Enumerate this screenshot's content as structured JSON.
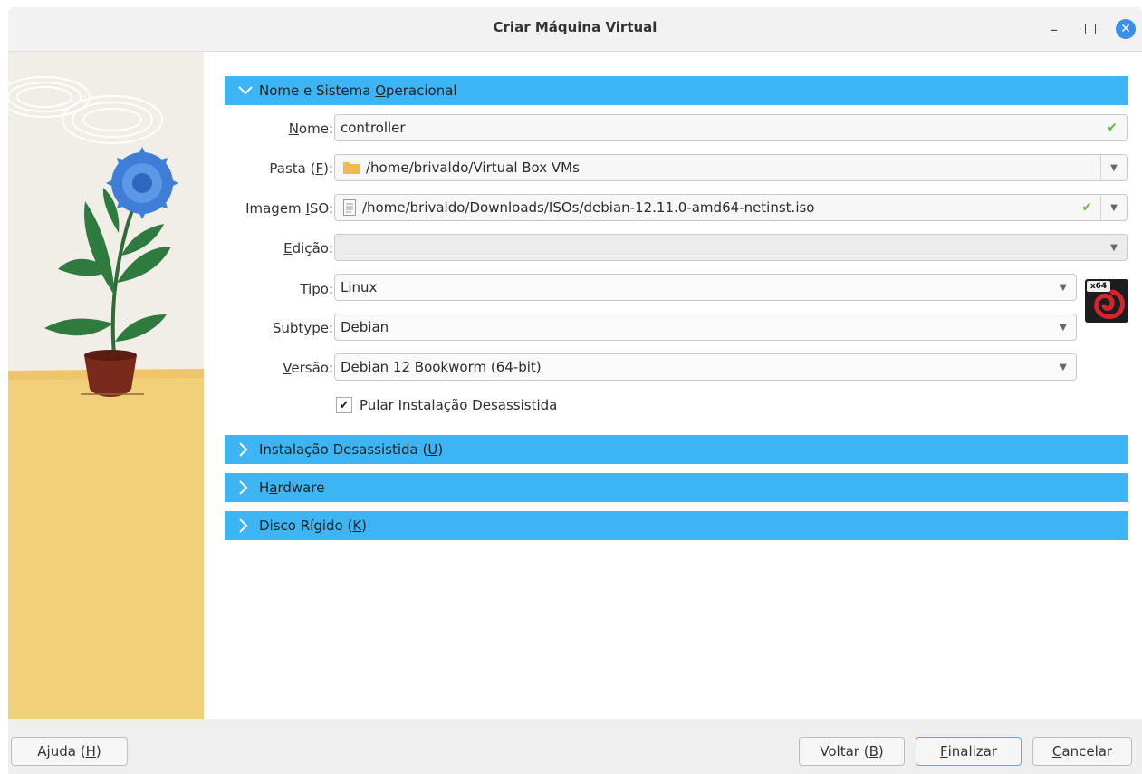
{
  "window": {
    "title": "Criar Máquina Virtual",
    "minimize_glyph": "–",
    "close_glyph": "✕"
  },
  "sections": {
    "name_os": {
      "label_pre": "Nome e Sistema ",
      "label_u": "O",
      "label_post": "peracional",
      "expanded": true
    },
    "unattended": {
      "label_pre": "Instalação Desassistida (",
      "label_u": "U",
      "label_post": ")",
      "expanded": false
    },
    "hardware": {
      "label_pre": "H",
      "label_u": "a",
      "label_post": "rdware",
      "expanded": false
    },
    "disk": {
      "label_pre": "Disco Rígido (",
      "label_u": "K",
      "label_post": ")",
      "expanded": false
    }
  },
  "form": {
    "name": {
      "label_pre": "",
      "label_u": "N",
      "label_post": "ome:",
      "value": "controller"
    },
    "folder": {
      "label_pre": "Pasta (",
      "label_u": "F",
      "label_post": "):",
      "value": "/home/brivaldo/Virtual Box VMs"
    },
    "iso": {
      "label_pre": "Imagem ",
      "label_u": "I",
      "label_post": "SO:",
      "value": "/home/brivaldo/Downloads/ISOs/debian-12.11.0-amd64-netinst.iso"
    },
    "edition": {
      "label_pre": "",
      "label_u": "E",
      "label_post": "dição:",
      "value": ""
    },
    "type": {
      "label_pre": "",
      "label_u": "T",
      "label_post": "ipo:",
      "value": "Linux"
    },
    "subtype": {
      "label_pre": "",
      "label_u": "S",
      "label_post": "ubtype:",
      "value": "Debian"
    },
    "version": {
      "label_pre": "",
      "label_u": "V",
      "label_post": "ersão:",
      "value": "Debian 12 Bookworm (64-bit)"
    },
    "skip_unattended": {
      "label_pre": "Pular Instalação De",
      "label_u": "s",
      "label_post": "assistida",
      "checked": true,
      "glyph": "✔"
    },
    "os_badge": "x64"
  },
  "footer": {
    "help": {
      "label_pre": "Ajuda (",
      "label_u": "H",
      "label_post": ")"
    },
    "back": {
      "label_pre": "Voltar (",
      "label_u": "B",
      "label_post": ")"
    },
    "finish": {
      "label_pre": "",
      "label_u": "F",
      "label_post": "inalizar"
    },
    "cancel": {
      "label_pre": "",
      "label_u": "C",
      "label_post": "ancelar"
    }
  },
  "colors": {
    "section_bar": "#3db5f4",
    "accent": "#3a8fe8",
    "ok_check": "#5fbf3a",
    "folder": "#f3b84e"
  },
  "icons": [
    "chevron-down-icon",
    "chevron-right-icon",
    "folder-icon",
    "file-icon",
    "check-icon",
    "dropdown-arrow-icon",
    "debian-icon"
  ]
}
